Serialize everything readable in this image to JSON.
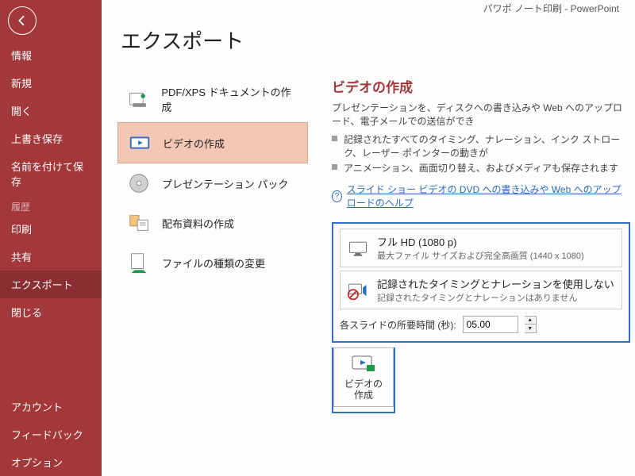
{
  "titlebar": "パワポ ノート印刷  -  PowerPoint",
  "page_title": "エクスポート",
  "sidebar": {
    "items": [
      "情報",
      "新規",
      "開く",
      "上書き保存",
      "名前を付けて保存",
      "印刷",
      "共有",
      "エクスポート",
      "閉じる"
    ],
    "section_label": "履歴",
    "footer_items": [
      "アカウント",
      "フィードバック",
      "オプション"
    ],
    "selected": "エクスポート"
  },
  "export_options": {
    "items": [
      "PDF/XPS ドキュメントの作成",
      "ビデオの作成",
      "プレゼンテーション パック",
      "配布資料の作成",
      "ファイルの種類の変更"
    ],
    "selected_index": 1
  },
  "detail": {
    "heading": "ビデオの作成",
    "subtitle": "プレゼンテーションを、ディスクへの書き込みや Web へのアップロード、電子メールでの送信ができ",
    "bullets": [
      "記録されたすべてのタイミング、ナレーション、インク ストローク、レーザー ポインターの動きが",
      "アニメーション、画面切り替え、およびメディアも保存されます"
    ],
    "help_link": "スライド ショー ビデオの DVD への書き込みや Web へのアップロードのヘルプ",
    "quality": {
      "primary": "フル HD (1080 p)",
      "secondary": "最大ファイル サイズおよび完全高画質 (1440 x 1080)"
    },
    "timing": {
      "primary": "記録されたタイミングとナレーションを使用しない",
      "secondary": "記録されたタイミングとナレーションはありません"
    },
    "duration_label": "各スライドの所要時間 (秒):",
    "duration_value": "05.00",
    "create_button_label": "ビデオの\n作成"
  }
}
